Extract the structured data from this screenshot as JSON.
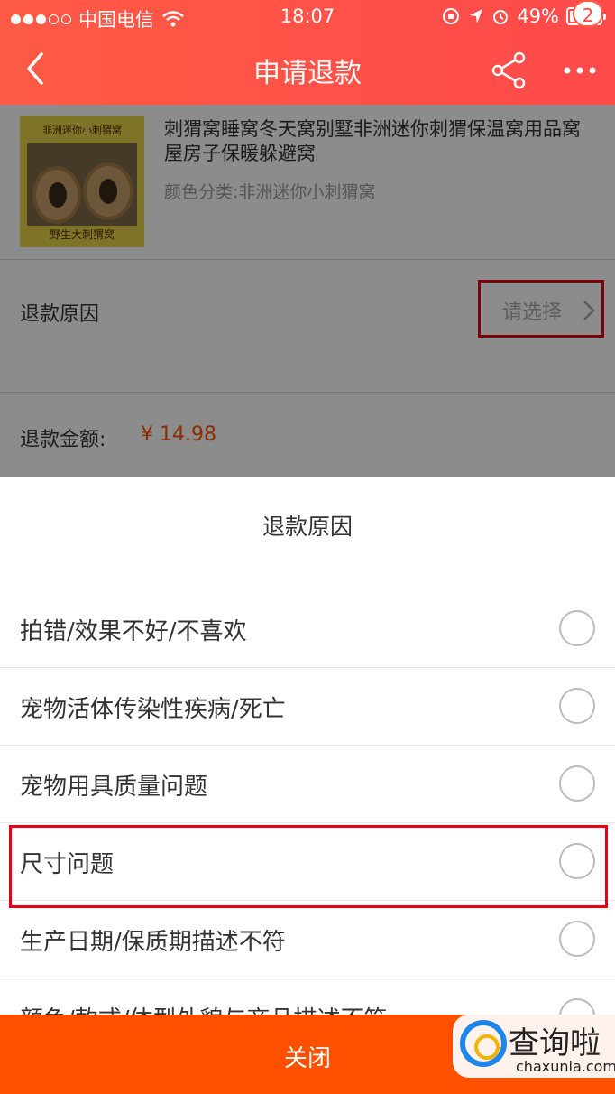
{
  "status_bar": {
    "carrier": "中国电信",
    "time": "18:07",
    "battery": "49%",
    "battery_level": 0.49
  },
  "nav": {
    "title": "申请退款",
    "badge_count": "2"
  },
  "product": {
    "image_label_top": "非洲迷你小刺猬窝",
    "image_label_bottom": "野生大刺猬窝",
    "title": "刺猬窝睡窝冬天窝别墅非洲迷你刺猬保温窝用品窝屋房子保暖躲避窝",
    "variant": "颜色分类:非洲迷你小刺猬窝"
  },
  "refund": {
    "reason_label": "退款原因",
    "reason_placeholder": "请选择",
    "amount_label": "退款金额:",
    "amount_value": "¥ 14.98"
  },
  "sheet": {
    "title": "退款原因",
    "options": [
      "拍错/效果不好/不喜欢",
      "宠物活体传染性疾病/死亡",
      "宠物用具质量问题",
      "尺寸问题",
      "生产日期/保质期描述不符",
      "颜色/款式/体型外貌与商品描述不符"
    ],
    "close_label": "关闭"
  },
  "watermark": {
    "cn": "查询啦",
    "en": "chaxunla.com"
  },
  "colors": {
    "header": "#ff4a4a",
    "price": "#ff5000",
    "close_bar": "#ff5000",
    "highlight_box": "#e60012"
  }
}
